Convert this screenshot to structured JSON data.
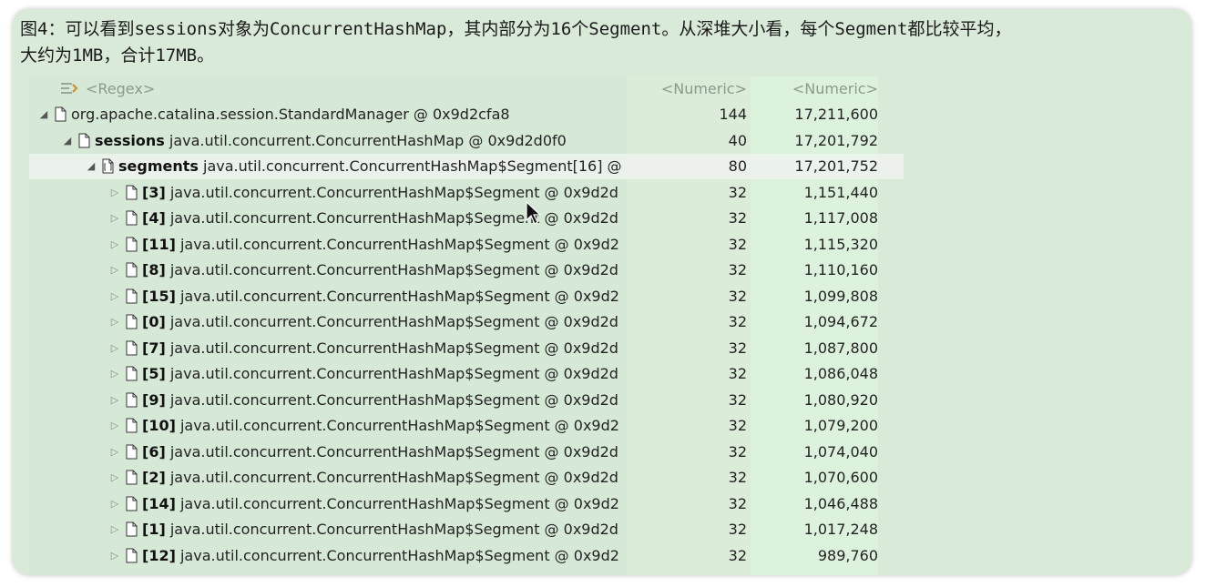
{
  "caption": {
    "line1": "图4：可以看到sessions对象为ConcurrentHashMap，其内部分为16个Segment。从深堆大小看，每个Segment都比较平均，",
    "line2": "大约为1MB，合计17MB。"
  },
  "header": {
    "filter_placeholder": "<Regex>",
    "shallow_placeholder": "<Numeric>",
    "retained_placeholder": "<Numeric>"
  },
  "rows": [
    {
      "level": 0,
      "expander": "expanded",
      "icon": "document-icon",
      "label": "",
      "text": "org.apache.catalina.session.StandardManager @ 0x9d2cfa8",
      "shallow": "144",
      "retained": "17,211,600"
    },
    {
      "level": 1,
      "expander": "expanded",
      "icon": "document-icon",
      "label": "sessions",
      "text": " java.util.concurrent.ConcurrentHashMap @ 0x9d2d0f0",
      "shallow": "40",
      "retained": "17,201,792"
    },
    {
      "level": 2,
      "expander": "expanded",
      "icon": "array-icon",
      "label": "segments",
      "text": " java.util.concurrent.ConcurrentHashMap$Segment[16] @",
      "shallow": "80",
      "retained": "17,201,752",
      "selected": true
    },
    {
      "level": 3,
      "expander": "collapsed",
      "icon": "document-icon",
      "label": "[3]",
      "text": " java.util.concurrent.ConcurrentHashMap$Segment @ 0x9d2d",
      "shallow": "32",
      "retained": "1,151,440"
    },
    {
      "level": 3,
      "expander": "collapsed",
      "icon": "document-icon",
      "label": "[4]",
      "text": " java.util.concurrent.ConcurrentHashMap$Segment @ 0x9d2d",
      "shallow": "32",
      "retained": "1,117,008"
    },
    {
      "level": 3,
      "expander": "collapsed",
      "icon": "document-icon",
      "label": "[11]",
      "text": " java.util.concurrent.ConcurrentHashMap$Segment @ 0x9d2",
      "shallow": "32",
      "retained": "1,115,320"
    },
    {
      "level": 3,
      "expander": "collapsed",
      "icon": "document-icon",
      "label": "[8]",
      "text": " java.util.concurrent.ConcurrentHashMap$Segment @ 0x9d2d",
      "shallow": "32",
      "retained": "1,110,160"
    },
    {
      "level": 3,
      "expander": "collapsed",
      "icon": "document-icon",
      "label": "[15]",
      "text": " java.util.concurrent.ConcurrentHashMap$Segment @ 0x9d2",
      "shallow": "32",
      "retained": "1,099,808"
    },
    {
      "level": 3,
      "expander": "collapsed",
      "icon": "document-icon",
      "label": "[0]",
      "text": " java.util.concurrent.ConcurrentHashMap$Segment @ 0x9d2d",
      "shallow": "32",
      "retained": "1,094,672"
    },
    {
      "level": 3,
      "expander": "collapsed",
      "icon": "document-icon",
      "label": "[7]",
      "text": " java.util.concurrent.ConcurrentHashMap$Segment @ 0x9d2d",
      "shallow": "32",
      "retained": "1,087,800"
    },
    {
      "level": 3,
      "expander": "collapsed",
      "icon": "document-icon",
      "label": "[5]",
      "text": " java.util.concurrent.ConcurrentHashMap$Segment @ 0x9d2d",
      "shallow": "32",
      "retained": "1,086,048"
    },
    {
      "level": 3,
      "expander": "collapsed",
      "icon": "document-icon",
      "label": "[9]",
      "text": " java.util.concurrent.ConcurrentHashMap$Segment @ 0x9d2d",
      "shallow": "32",
      "retained": "1,080,920"
    },
    {
      "level": 3,
      "expander": "collapsed",
      "icon": "document-icon",
      "label": "[10]",
      "text": " java.util.concurrent.ConcurrentHashMap$Segment @ 0x9d2",
      "shallow": "32",
      "retained": "1,079,200"
    },
    {
      "level": 3,
      "expander": "collapsed",
      "icon": "document-icon",
      "label": "[6]",
      "text": " java.util.concurrent.ConcurrentHashMap$Segment @ 0x9d2d",
      "shallow": "32",
      "retained": "1,074,040"
    },
    {
      "level": 3,
      "expander": "collapsed",
      "icon": "document-icon",
      "label": "[2]",
      "text": " java.util.concurrent.ConcurrentHashMap$Segment @ 0x9d2d",
      "shallow": "32",
      "retained": "1,070,600"
    },
    {
      "level": 3,
      "expander": "collapsed",
      "icon": "document-icon",
      "label": "[14]",
      "text": " java.util.concurrent.ConcurrentHashMap$Segment @ 0x9d2",
      "shallow": "32",
      "retained": "1,046,488"
    },
    {
      "level": 3,
      "expander": "collapsed",
      "icon": "document-icon",
      "label": "[1]",
      "text": " java.util.concurrent.ConcurrentHashMap$Segment @ 0x9d2d",
      "shallow": "32",
      "retained": "1,017,248"
    },
    {
      "level": 3,
      "expander": "collapsed",
      "icon": "document-icon",
      "label": "[12]",
      "text": " java.util.concurrent.ConcurrentHashMap$Segment @ 0x9d2",
      "shallow": "32",
      "retained": "989,760"
    }
  ]
}
